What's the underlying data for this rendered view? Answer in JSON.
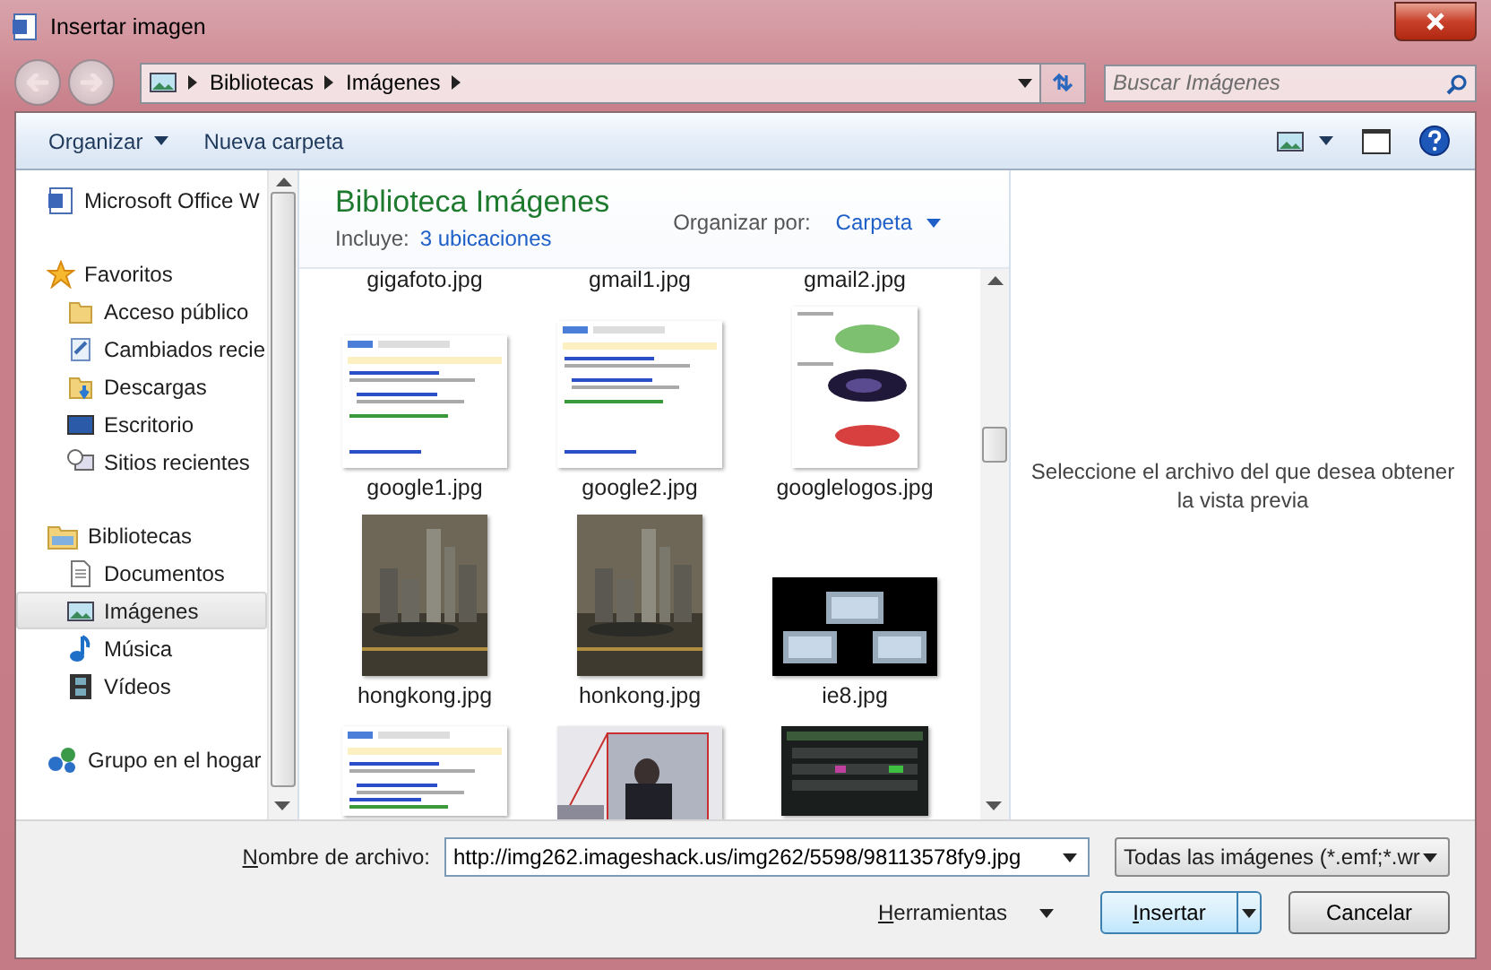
{
  "window": {
    "title": "Insertar imagen"
  },
  "address": {
    "crumbs": [
      "Bibliotecas",
      "Imágenes"
    ]
  },
  "search": {
    "placeholder": "Buscar Imágenes"
  },
  "toolbar": {
    "buttons": [
      "Organizar",
      "Nueva carpeta"
    ]
  },
  "sidebar": {
    "items": [
      {
        "label": "Microsoft Office W",
        "selected": false
      },
      {
        "label": "Favoritos",
        "selected": false,
        "children": [
          {
            "label": "Acceso público",
            "selected": false
          },
          {
            "label": "Cambiados recie",
            "selected": false
          },
          {
            "label": "Descargas",
            "selected": false
          },
          {
            "label": "Escritorio",
            "selected": false
          },
          {
            "label": "Sitios recientes",
            "selected": false
          }
        ]
      },
      {
        "label": "Bibliotecas",
        "selected": false,
        "children": [
          {
            "label": "Documentos",
            "selected": false
          },
          {
            "label": "Imágenes",
            "selected": true
          },
          {
            "label": "Música",
            "selected": false
          },
          {
            "label": "Vídeos",
            "selected": false
          }
        ]
      },
      {
        "label": "Grupo en el hogar",
        "selected": false
      }
    ]
  },
  "library": {
    "title": "Biblioteca Imágenes",
    "includes_label": "Incluye:",
    "includes_link": "3 ubicaciones",
    "arrange_label": "Organizar por:",
    "arrange_value": "Carpeta"
  },
  "files": [
    {
      "name": "gigafoto.jpg"
    },
    {
      "name": "gmail1.jpg"
    },
    {
      "name": "gmail2.jpg"
    },
    {
      "name": "google1.jpg",
      "kind": "picture"
    },
    {
      "name": "google2.jpg",
      "kind": "picture"
    },
    {
      "name": "googlelogos.jpg",
      "kind": "picture"
    },
    {
      "name": "hongkong.jpg",
      "kind": "picture"
    },
    {
      "name": "honkong.jpg",
      "kind": "picture"
    },
    {
      "name": "ie8.jpg",
      "kind": "picture"
    },
    {
      "kind": "picture"
    },
    {
      "kind": "picture"
    },
    {
      "kind": "picture"
    }
  ],
  "preview": {
    "message": "Seleccione el archivo del que desea obtener la vista previa"
  },
  "footer": {
    "filename_label": "Nombre de archivo:",
    "filename_value": "http://img262.imageshack.us/img262/5598/98113578fy9.jpg",
    "filter": "Todas las imágenes (*.emf;*.wr",
    "tools": "Herramientas",
    "buttons": [
      "Insertar",
      "Cancelar"
    ]
  }
}
